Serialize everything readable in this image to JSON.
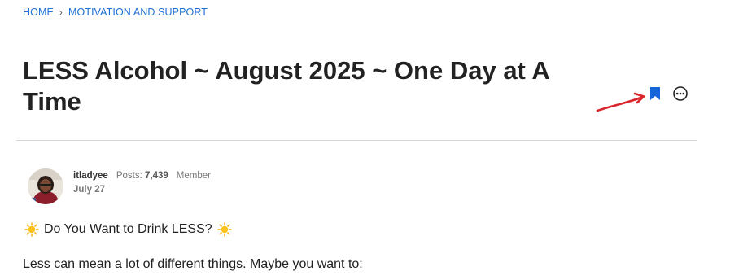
{
  "breadcrumb": {
    "home": "HOME",
    "separator": "›",
    "category": "MOTIVATION AND SUPPORT"
  },
  "title": "LESS Alcohol ~ August 2025 ~ One Day at A Time",
  "actions": {
    "bookmark_icon": "bookmark-icon",
    "options_icon": "more-options-icon",
    "arrow_annotation": "red-arrow-pointing-to-bookmark"
  },
  "post": {
    "author": "itladyee",
    "posts_label": "Posts:",
    "posts_count": "7,439",
    "role": "Member",
    "date": "July 27"
  },
  "body": {
    "line1": "Do You Want to Drink LESS?",
    "line1_icon": "sun-emoji",
    "line2": "Less can mean a lot of different things. Maybe you want to:"
  },
  "colors": {
    "link": "#1f6fd6",
    "bookmark": "#1565d8",
    "annotation": "#d9262c",
    "title": "#222222"
  }
}
